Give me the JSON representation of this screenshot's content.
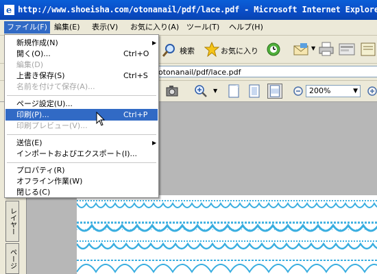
{
  "window": {
    "title": "http://www.shoeisha.com/otonanail/pdf/lace.pdf - Microsoft Internet Explorer"
  },
  "menubar": {
    "items": [
      "ファイル(F)",
      "編集(E)",
      "表示(V)",
      "お気に入り(A)",
      "ツール(T)",
      "ヘルプ(H)"
    ],
    "active_index": 0
  },
  "toolbar": {
    "search_label": "検索",
    "favorites_label": "お気に入り"
  },
  "address": {
    "value_visible": "otonanail/pdf/lace.pdf"
  },
  "pdf_toolbar": {
    "zoom": "200%"
  },
  "side_tabs": [
    "レイヤー",
    "ページ"
  ],
  "file_menu": {
    "items": [
      {
        "label": "新規作成(N)",
        "shortcut": "",
        "submenu": true,
        "disabled": false,
        "highlighted": false
      },
      {
        "label": "開く(O)...",
        "shortcut": "Ctrl+O",
        "submenu": false,
        "disabled": false,
        "highlighted": false
      },
      {
        "label": "編集(D)",
        "shortcut": "",
        "submenu": false,
        "disabled": true,
        "highlighted": false
      },
      {
        "label": "上書き保存(S)",
        "shortcut": "Ctrl+S",
        "submenu": false,
        "disabled": false,
        "highlighted": false
      },
      {
        "label": "名前を付けて保存(A)...",
        "shortcut": "",
        "submenu": false,
        "disabled": true,
        "highlighted": false
      },
      {
        "label": "ページ設定(U)...",
        "shortcut": "",
        "submenu": false,
        "disabled": false,
        "highlighted": false
      },
      {
        "label": "印刷(P)...",
        "shortcut": "Ctrl+P",
        "submenu": false,
        "disabled": false,
        "highlighted": true
      },
      {
        "label": "印刷プレビュー(V)...",
        "shortcut": "",
        "submenu": false,
        "disabled": true,
        "highlighted": false
      },
      {
        "label": "送信(E)",
        "shortcut": "",
        "submenu": true,
        "disabled": false,
        "highlighted": false
      },
      {
        "label": "インポートおよびエクスポート(I)...",
        "shortcut": "",
        "submenu": false,
        "disabled": false,
        "highlighted": false
      },
      {
        "label": "プロパティ(R)",
        "shortcut": "",
        "submenu": false,
        "disabled": false,
        "highlighted": false
      },
      {
        "label": "オフライン作業(W)",
        "shortcut": "",
        "submenu": false,
        "disabled": false,
        "highlighted": false
      },
      {
        "label": "閉じる(C)",
        "shortcut": "",
        "submenu": false,
        "disabled": false,
        "highlighted": false
      }
    ]
  },
  "colors": {
    "title_blue": "#0a4cc5",
    "highlight": "#316ac5",
    "lace": "#3aaee0"
  }
}
